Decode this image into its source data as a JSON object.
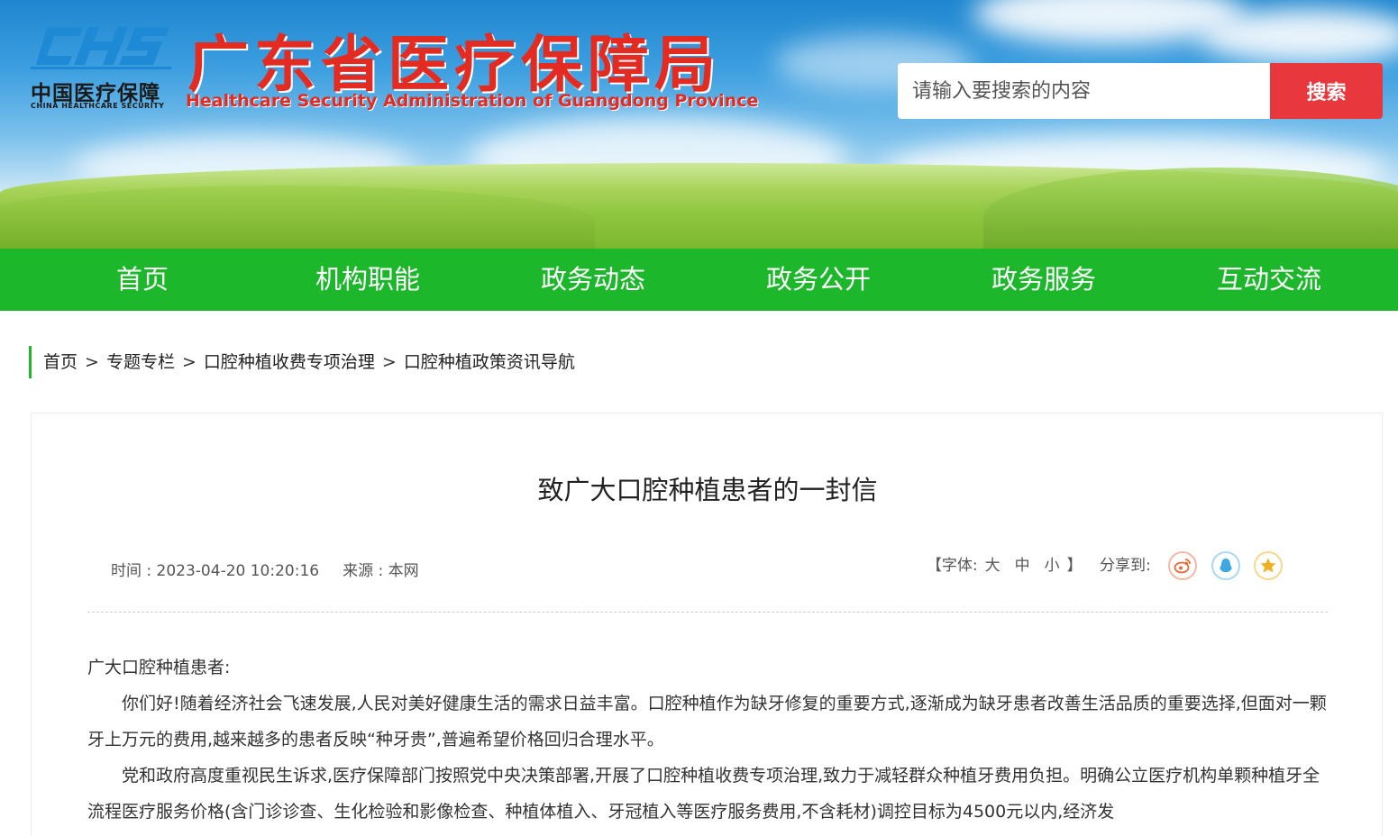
{
  "header": {
    "logo_cn": "中国医疗保障",
    "logo_en": "CHINA HEALTHCARE SECURITY",
    "title": "广东省医疗保障局",
    "subtitle": "Healthcare Security Administration of Guangdong Province"
  },
  "search": {
    "placeholder": "请输入要搜索的内容",
    "button": "搜索"
  },
  "nav": [
    "首页",
    "机构职能",
    "政务动态",
    "政务公开",
    "政务服务",
    "互动交流"
  ],
  "breadcrumb": [
    "首页",
    "专题专栏",
    "口腔种植收费专项治理",
    "口腔种植政策资讯导航"
  ],
  "breadcrumb_sep": ">",
  "article": {
    "title": "致广大口腔种植患者的一封信",
    "time": "时间 : 2023-04-20 10:20:16",
    "source": "来源 : 本网",
    "font_label_open": "【字体:",
    "font_large": "大",
    "font_medium": "中",
    "font_small": "小",
    "font_label_close": "】",
    "share_label": "分享到:",
    "greeting": "广大口腔种植患者:",
    "paragraphs": [
      "你们好!随着经济社会飞速发展,人民对美好健康生活的需求日益丰富。口腔种植作为缺牙修复的重要方式,逐渐成为缺牙患者改善生活品质的重要选择,但面对一颗牙上万元的费用,越来越多的患者反映“种牙贵”,普遍希望价格回归合理水平。",
      "党和政府高度重视民生诉求,医疗保障部门按照党中央决策部署,开展了口腔种植收费专项治理,致力于减轻群众种植牙费用负担。明确公立医疗机构单颗种植牙全流程医疗服务价格(含门诊诊查、生化检验和影像检查、种植体植入、牙冠植入等医疗服务费用,不含耗材)调控目标为4500元以内,经济发"
    ]
  },
  "colors": {
    "nav_green": "#1db72b",
    "title_red": "#e32b22",
    "search_red": "#e8383d",
    "weibo": "#e86a3a",
    "qq": "#3fa8e0",
    "qzone": "#f0b020"
  }
}
